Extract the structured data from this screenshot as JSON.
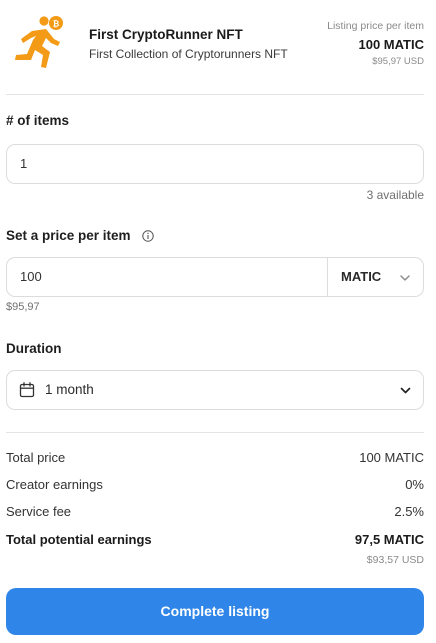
{
  "header": {
    "nft_name": "First CryptoRunner NFT",
    "collection_name": "First Collection of Cryptorunners NFT",
    "listing_price_label": "Listing price per item",
    "listing_price_value": "100 MATIC",
    "listing_price_usd": "$95,97 USD",
    "thumbnail_icon": "running-man-with-bitcoin-icon"
  },
  "items": {
    "label": "# of items",
    "value": "1",
    "available": "3 available"
  },
  "price": {
    "label": "Set a price per item",
    "info_icon": "info-icon",
    "value": "100",
    "currency": "MATIC",
    "usd": "$95,97"
  },
  "duration": {
    "label": "Duration",
    "value": "1 month"
  },
  "summary": {
    "rows": [
      {
        "label": "Total price",
        "value": "100 MATIC"
      },
      {
        "label": "Creator earnings",
        "value": "0%"
      },
      {
        "label": "Service fee",
        "value": "2.5%"
      },
      {
        "label": "Total potential earnings",
        "value": "97,5 MATIC"
      }
    ],
    "total_usd": "$93,57 USD"
  },
  "cta": {
    "label": "Complete listing"
  },
  "colors": {
    "accent": "#2f86e8",
    "runner_orange": "#f39a16",
    "border": "#dcdcdc"
  }
}
